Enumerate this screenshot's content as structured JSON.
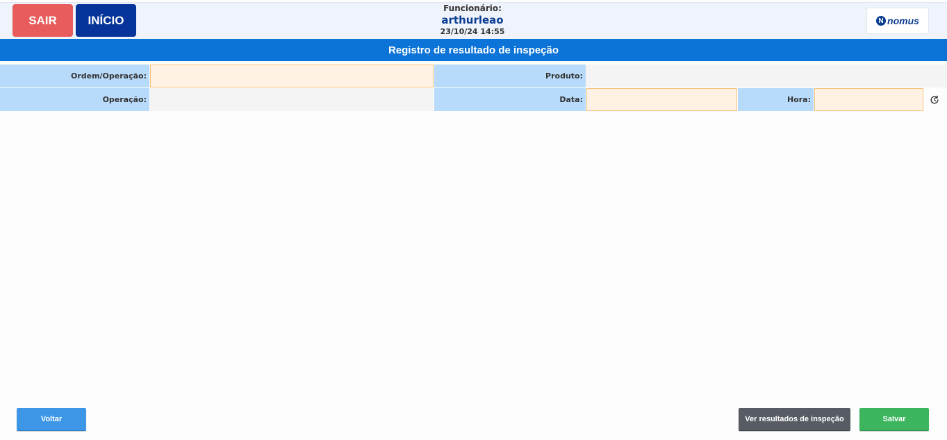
{
  "header": {
    "exit_label": "SAIR",
    "home_label": "INÍCIO",
    "employee_label": "Funcionário:",
    "employee_name": "arthurleao",
    "datetime": "23/10/24 14:55",
    "logo_text": "nomus"
  },
  "page_title": "Registro de resultado de inspeção",
  "form": {
    "ordem_label": "Ordem/Operação:",
    "ordem_value": "",
    "produto_label": "Produto:",
    "produto_value": "",
    "operacao_label": "Operação:",
    "operacao_value": "",
    "data_label": "Data:",
    "data_value": "",
    "hora_label": "Hora:",
    "hora_value": ""
  },
  "footer": {
    "back_label": "Voltar",
    "view_results_label": "Ver resultados de inspeção",
    "save_label": "Salvar"
  },
  "colors": {
    "exit": "#e85c5c",
    "home": "#06349a",
    "title_bar": "#0c74d8",
    "label_bg": "#b9dbfb",
    "input_bg": "#fff2e5",
    "input_border": "#f5c27a",
    "back": "#3e97e6",
    "view_results": "#575c64",
    "save": "#3cb55e"
  },
  "icons": {
    "refresh": "refresh-clock-icon",
    "logo": "nomus-logo-icon"
  }
}
